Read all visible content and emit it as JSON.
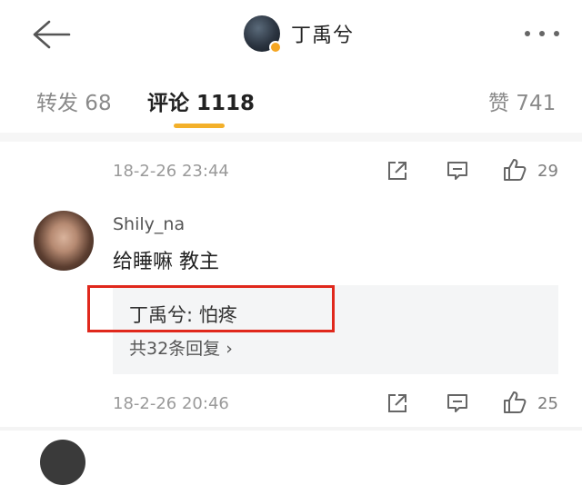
{
  "header": {
    "title": "丁禹兮",
    "back_icon": "arrow-left-icon",
    "more_icon": "more-horizontal-icon"
  },
  "tabs": [
    {
      "label": "转发 68"
    },
    {
      "label": "评论 1118",
      "active": true
    },
    {
      "label": "赞 741"
    }
  ],
  "prev_comment_footer": {
    "time": "18-2-26 23:44",
    "likes": "29"
  },
  "comment": {
    "username": "Shily_na",
    "text": "给睡嘛 教主",
    "reply_author": "丁禹兮",
    "reply_separator": ": ",
    "reply_text": "怕疼",
    "more_replies": "共32条回复 ›",
    "time": "18-2-26 20:46",
    "likes": "25"
  },
  "colors": {
    "accent": "#f3b02a",
    "highlight_box": "#e0281c",
    "reply_bg": "#f4f5f6"
  }
}
